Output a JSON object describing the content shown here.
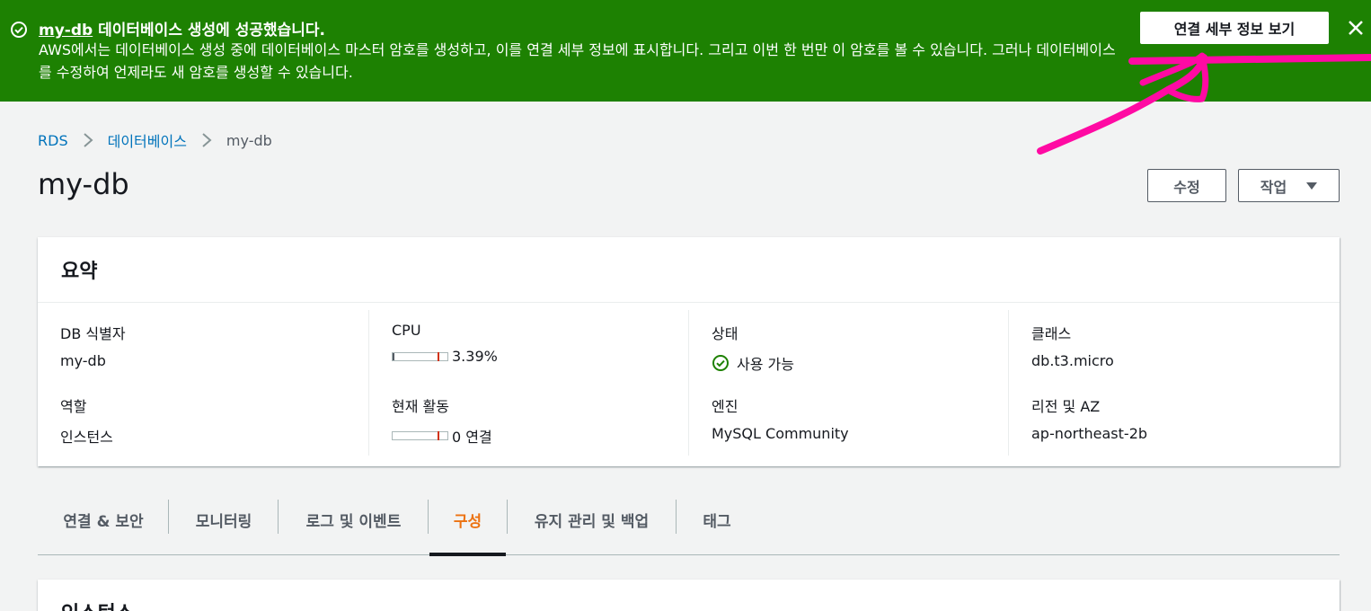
{
  "flash": {
    "db_name": "my-db",
    "title_rest": " 데이터베이스 생성에 성공했습니다.",
    "message": "AWS에서는 데이터베이스 생성 중에 데이터베이스 마스터 암호를 생성하고, 이를 연결 세부 정보에 표시합니다. 그리고 이번 한 번만 이 암호를 볼 수 있습니다. 그러나 데이터베이스를 수정하여 언제라도 새 암호를 생성할 수 있습니다.",
    "view_button": "연결 세부 정보 보기",
    "color": "#1d8102"
  },
  "annotation": {
    "color": "#ff0aa3"
  },
  "breadcrumb": {
    "items": [
      "RDS",
      "데이터베이스",
      "my-db"
    ]
  },
  "header": {
    "title": "my-db",
    "edit_button": "수정",
    "actions_button": "작업"
  },
  "summary": {
    "title": "요약",
    "db_identifier_label": "DB 식별자",
    "db_identifier_value": "my-db",
    "role_label": "역할",
    "role_value": "인스턴스",
    "cpu_label": "CPU",
    "cpu_value": "3.39%",
    "cpu_percent": 3.39,
    "activity_label": "현재 활동",
    "activity_value": "0 연결",
    "activity_count": 0,
    "status_label": "상태",
    "status_value": "사용 가능",
    "engine_label": "엔진",
    "engine_value": "MySQL Community",
    "class_label": "클래스",
    "class_value": "db.t3.micro",
    "region_label": "리전 및 AZ",
    "region_value": "ap-northeast-2b"
  },
  "tabs": [
    "연결 & 보안",
    "모니터링",
    "로그 및 이벤트",
    "구성",
    "유지 관리 및 백업",
    "태그"
  ],
  "active_tab": "구성",
  "instance": {
    "title": "인스턴스"
  }
}
